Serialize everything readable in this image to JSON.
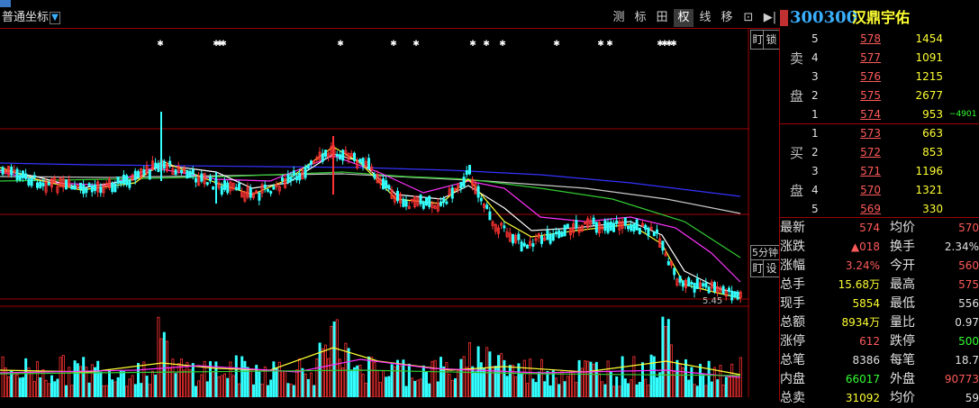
{
  "toolbar": {
    "indicator_label": "普通坐标",
    "indicator_arrow": "▼",
    "buttons": [
      "测",
      "标",
      "田",
      "权",
      "线",
      "移",
      "⊡",
      "▶|"
    ],
    "active_index": 3
  },
  "stock": {
    "badge": "融",
    "code": "300300",
    "name": "汉鼎宇佑"
  },
  "side_buttons": {
    "lock_left": "盯",
    "lock_right": "锁",
    "period_top": "5分钟",
    "period_bottom_left": "盯",
    "period_bottom_right": "设"
  },
  "chart_labels": {
    "low_price_label": "5.45"
  },
  "orderbook": {
    "sell_label_top": "卖",
    "sell_label_bottom": "盘",
    "buy_label_top": "买",
    "buy_label_bottom": "盘",
    "sell": [
      {
        "level": "5",
        "price": "578",
        "volume": "1454",
        "extra": ""
      },
      {
        "level": "4",
        "price": "577",
        "volume": "1091",
        "extra": ""
      },
      {
        "level": "3",
        "price": "576",
        "volume": "1215",
        "extra": ""
      },
      {
        "level": "2",
        "price": "575",
        "volume": "2677",
        "extra": ""
      },
      {
        "level": "1",
        "price": "574",
        "volume": "953",
        "extra": "−4901"
      }
    ],
    "buy": [
      {
        "level": "1",
        "price": "573",
        "volume": "663"
      },
      {
        "level": "2",
        "price": "572",
        "volume": "853"
      },
      {
        "level": "3",
        "price": "571",
        "volume": "1196"
      },
      {
        "level": "4",
        "price": "570",
        "volume": "1321"
      },
      {
        "level": "5",
        "price": "569",
        "volume": "330"
      }
    ]
  },
  "stats": [
    {
      "l1": "最新",
      "v1": "574",
      "c1": "red",
      "l2": "均价",
      "v2": "570",
      "c2": "red"
    },
    {
      "l1": "涨跌",
      "v1": "▲018",
      "c1": "red",
      "l2": "换手",
      "v2": "2.34%",
      "c2": "white"
    },
    {
      "l1": "涨幅",
      "v1": "3.24%",
      "c1": "red",
      "l2": "今开",
      "v2": "560",
      "c2": "red"
    },
    {
      "l1": "总手",
      "v1": "15.68万",
      "c1": "yellow",
      "l2": "最高",
      "v2": "575",
      "c2": "red"
    },
    {
      "l1": "现手",
      "v1": "5854",
      "c1": "yellow",
      "l2": "最低",
      "v2": "556",
      "c2": "white"
    },
    {
      "l1": "总额",
      "v1": "8934万",
      "c1": "yellow",
      "l2": "量比",
      "v2": "0.97",
      "c2": "white"
    },
    {
      "l1": "涨停",
      "v1": "612",
      "c1": "red",
      "l2": "跌停",
      "v2": "500",
      "c2": "green"
    },
    {
      "l1": "总笔",
      "v1": "8386",
      "c1": "white",
      "l2": "每笔",
      "v2": "18.7",
      "c2": "white"
    },
    {
      "l1": "内盘",
      "v1": "66017",
      "c1": "green",
      "l2": "外盘",
      "v2": "90773",
      "c2": "red"
    },
    {
      "l1": "总卖",
      "v1": "31092",
      "c1": "yellow",
      "l2": "均价",
      "v2": "59",
      "c2": "white"
    }
  ],
  "colors": {
    "up": "#ff3333",
    "down": "#33ffff",
    "ma_white": "#ffffff",
    "ma_yellow": "#ffff33",
    "ma_magenta": "#ff33ff",
    "ma_green": "#33cc33",
    "ma_gray": "#c8c8c8",
    "ma_blue": "#3333ff",
    "grid": "#a00000"
  }
}
